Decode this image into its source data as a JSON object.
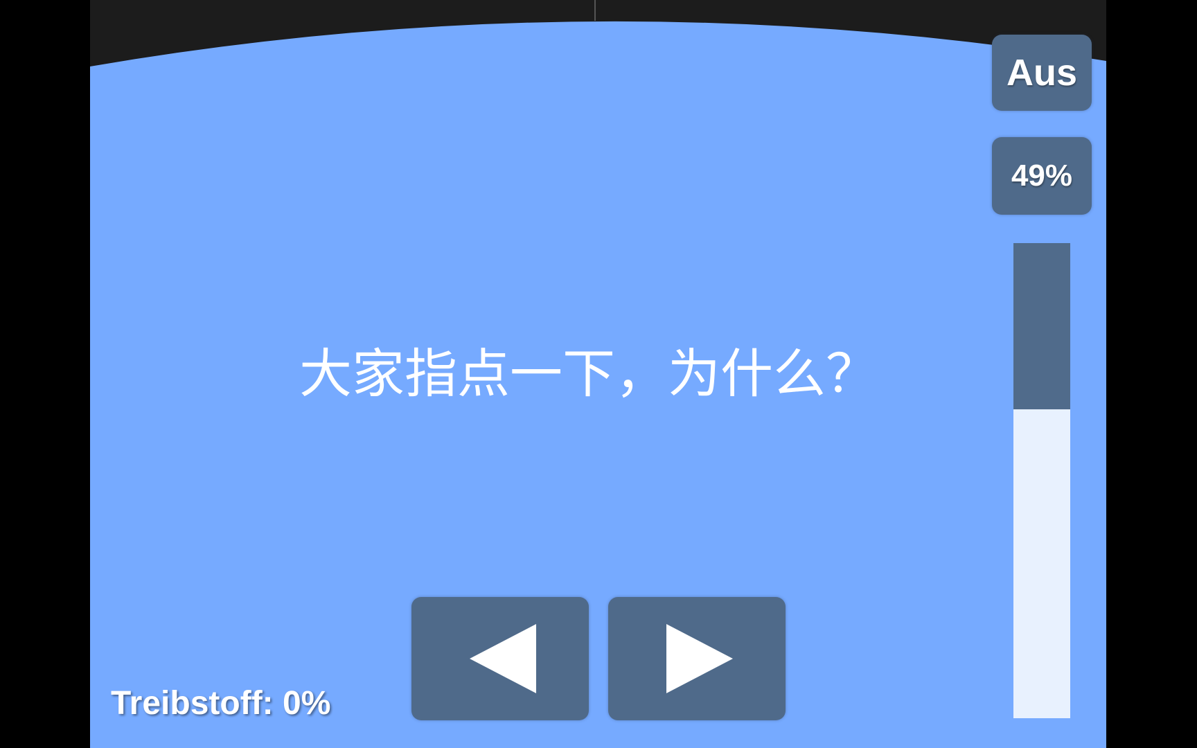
{
  "hud": {
    "engine_toggle_label": "Aus",
    "throttle_percent_label": "49%",
    "throttle_fraction": 0.35,
    "fuel_label": "Treibstoff: 0%"
  },
  "controls": {
    "prev_icon": "triangle-left-icon",
    "next_icon": "triangle-right-icon"
  },
  "overlay": {
    "caption": "大家指点一下，为什么？"
  },
  "colors": {
    "sky": "#76aaff",
    "space": "#1c1c1c",
    "button": "#4f6a8a",
    "bar_empty": "#e8f1fe"
  }
}
